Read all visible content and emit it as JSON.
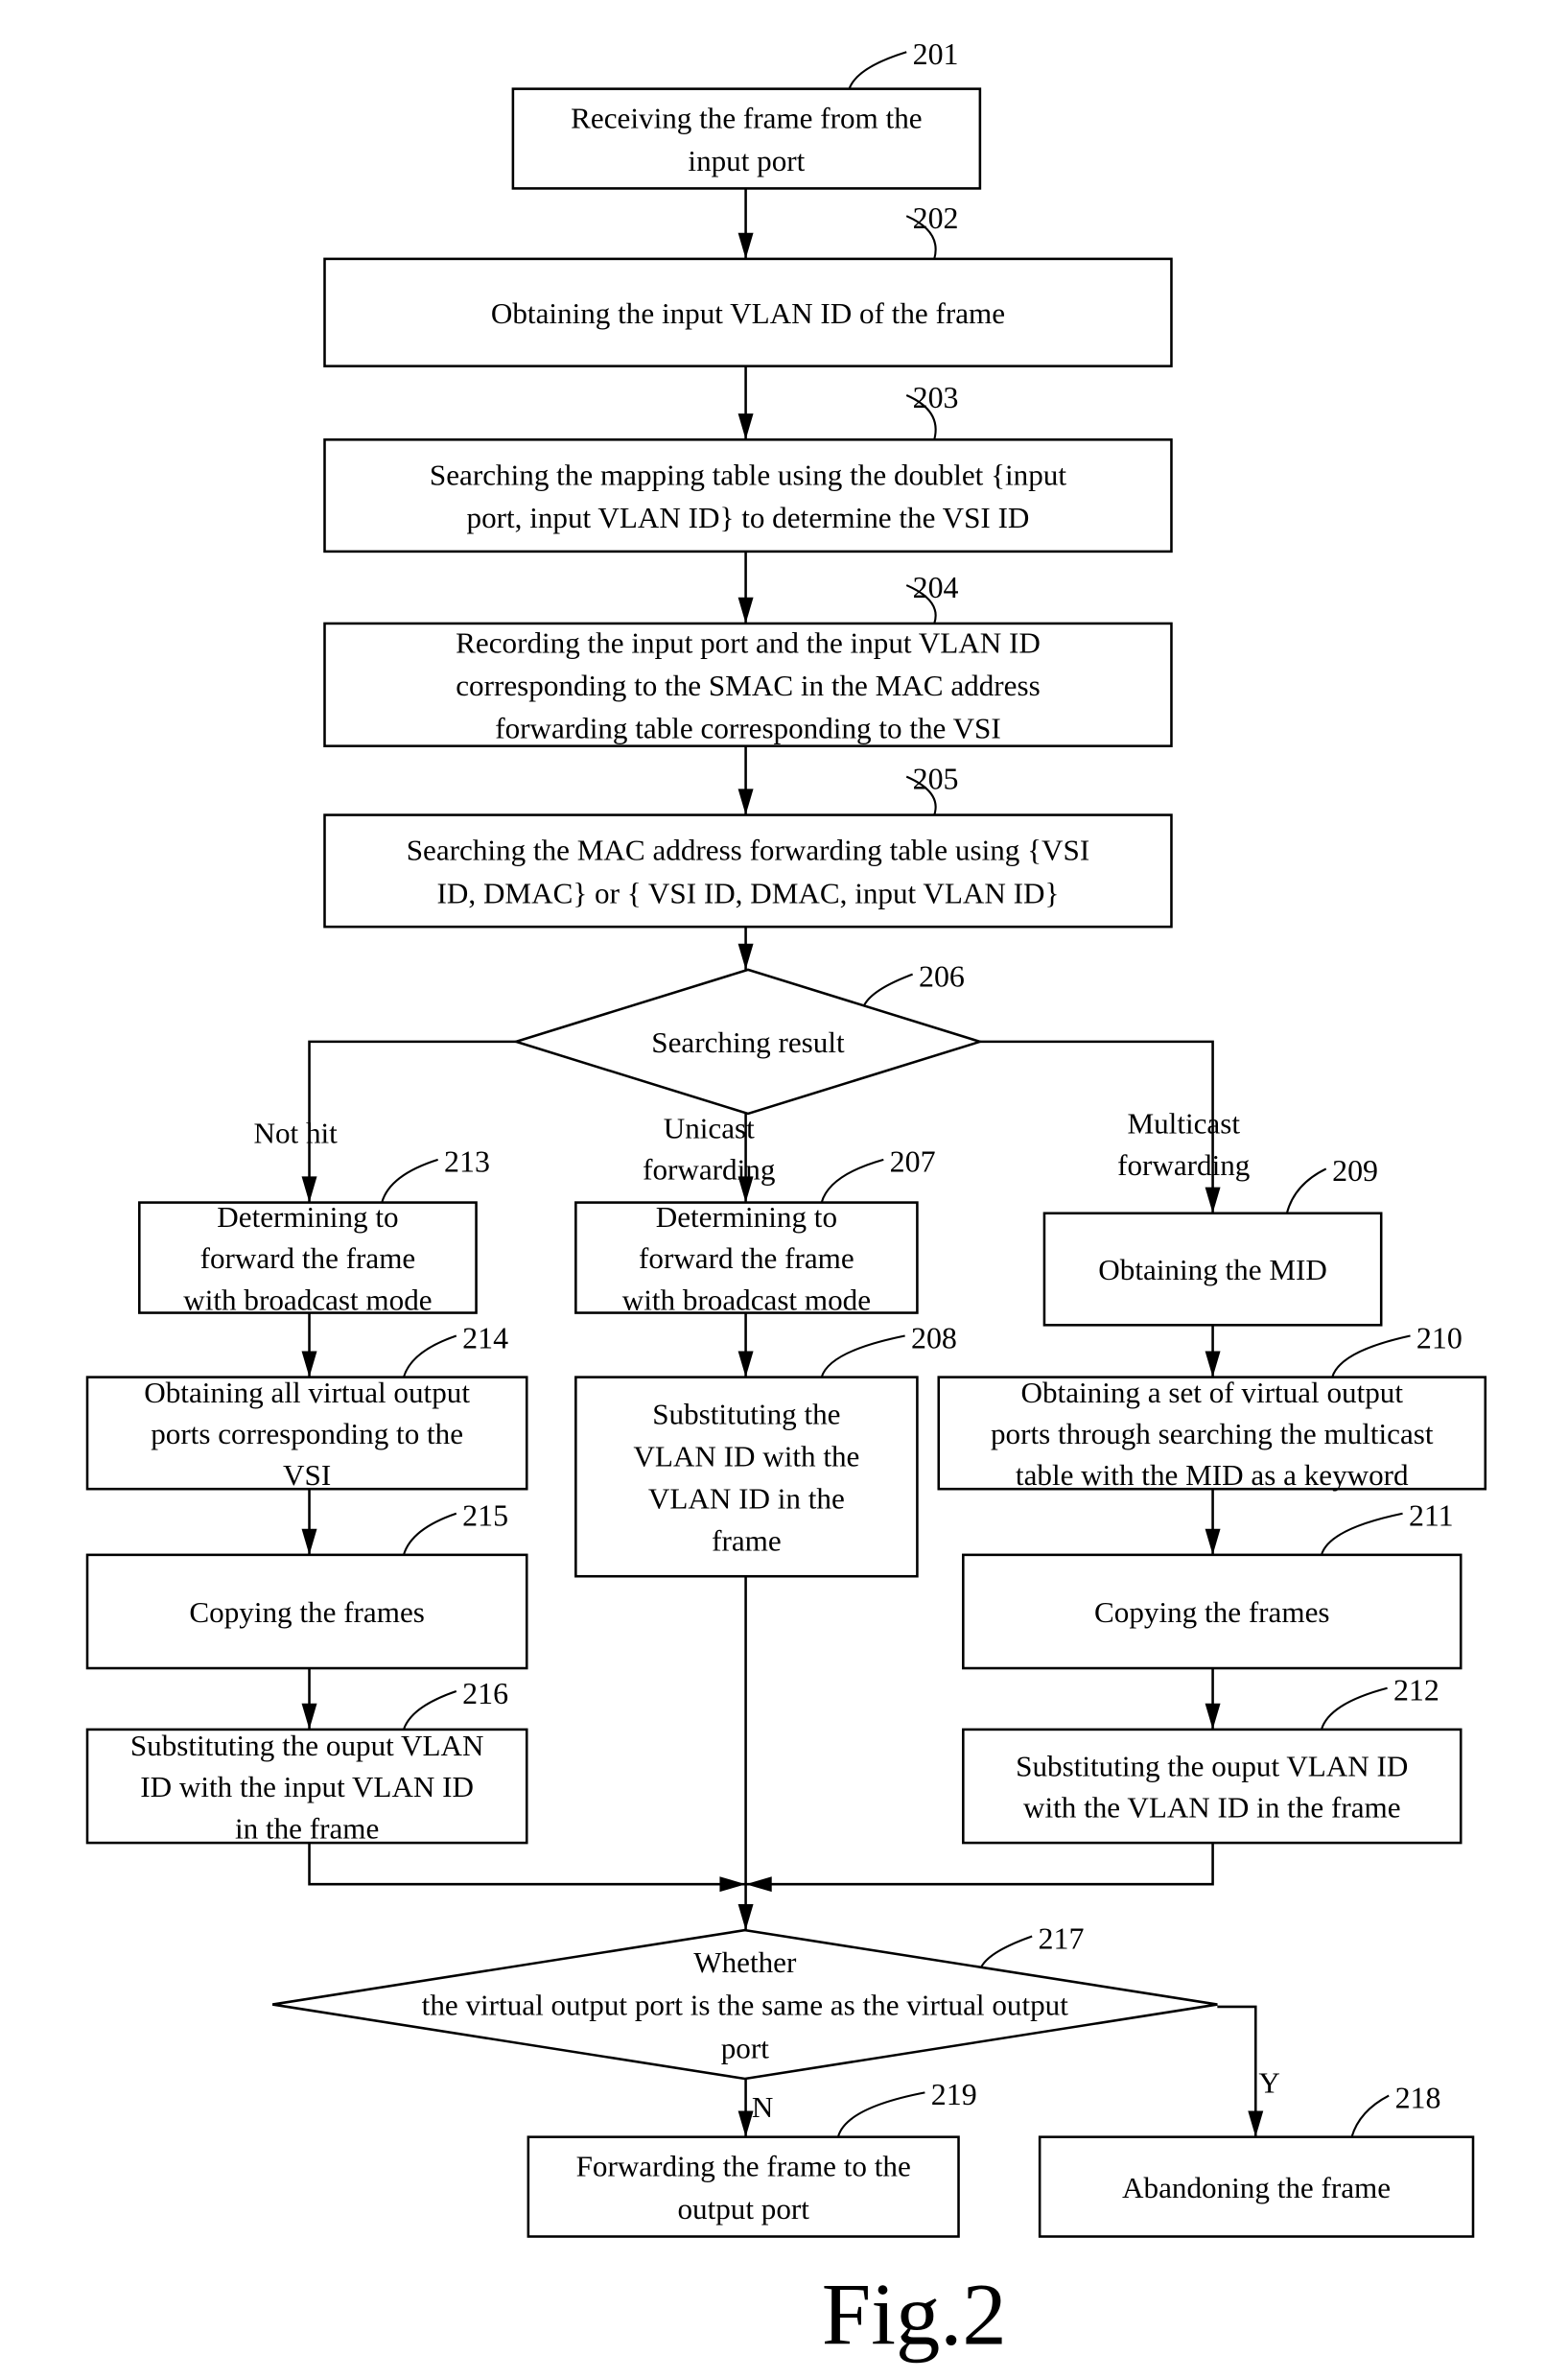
{
  "figure": {
    "caption": "Fig.2",
    "nodes": [
      {
        "id": "201",
        "type": "process",
        "lines": [
          "Receiving the frame from the",
          "input port"
        ]
      },
      {
        "id": "202",
        "type": "process",
        "lines": [
          "Obtaining the input VLAN ID of the frame"
        ]
      },
      {
        "id": "203",
        "type": "process",
        "lines": [
          "Searching the mapping table  using the doublet {input",
          "port, input VLAN ID}  to determine the VSI ID"
        ]
      },
      {
        "id": "204",
        "type": "process",
        "lines": [
          "Recording the input port and the input VLAN ID",
          "corresponding to the SMAC in the MAC address",
          "forwarding table corresponding to the VSI"
        ]
      },
      {
        "id": "205",
        "type": "process",
        "lines": [
          "Searching the MAC address forwarding table  using {VSI",
          "ID, DMAC} or { VSI ID, DMAC, input VLAN ID}"
        ]
      },
      {
        "id": "206",
        "type": "decision",
        "lines": [
          "Searching result"
        ]
      },
      {
        "id": "213",
        "type": "process",
        "lines": [
          "Determining to",
          "forward the frame",
          "with broadcast mode"
        ]
      },
      {
        "id": "214",
        "type": "process",
        "lines": [
          "Obtaining all virtual output",
          "ports corresponding to the",
          "VSI"
        ]
      },
      {
        "id": "215",
        "type": "process",
        "lines": [
          "Copying the frames"
        ]
      },
      {
        "id": "216",
        "type": "process",
        "lines": [
          "Substituting the ouput  VLAN",
          "ID with the input  VLAN ID",
          "in the frame"
        ]
      },
      {
        "id": "207",
        "type": "process",
        "lines": [
          "Determining to",
          "forward the frame",
          "with broadcast mode"
        ]
      },
      {
        "id": "208",
        "type": "process",
        "lines": [
          "Substituting the",
          "VLAN ID with the",
          "VLAN ID in the",
          "frame"
        ]
      },
      {
        "id": "209",
        "type": "process",
        "lines": [
          "Obtaining the MID"
        ]
      },
      {
        "id": "210",
        "type": "process",
        "lines": [
          "Obtaining a set of virtual output",
          "ports through searching the multicast",
          "table with the MID as a keyword"
        ]
      },
      {
        "id": "211",
        "type": "process",
        "lines": [
          "Copying the frames"
        ]
      },
      {
        "id": "212",
        "type": "process",
        "lines": [
          "Substituting the ouput  VLAN ID",
          "with the VLAN ID in the frame"
        ]
      },
      {
        "id": "217",
        "type": "decision",
        "lines": [
          "Whether",
          "the virtual output port is the same as the virtual output",
          "port"
        ]
      },
      {
        "id": "219",
        "type": "process",
        "lines": [
          "Forwarding the frame to the",
          "output port"
        ]
      },
      {
        "id": "218",
        "type": "process",
        "lines": [
          "Abandoning the frame"
        ]
      }
    ],
    "branch_labels": {
      "not_hit": [
        "Not hit"
      ],
      "unicast": [
        "Unicast",
        "forwarding"
      ],
      "multicast": [
        "Multicast",
        "forwarding"
      ],
      "no": [
        "N"
      ],
      "yes": [
        "Y"
      ]
    }
  }
}
